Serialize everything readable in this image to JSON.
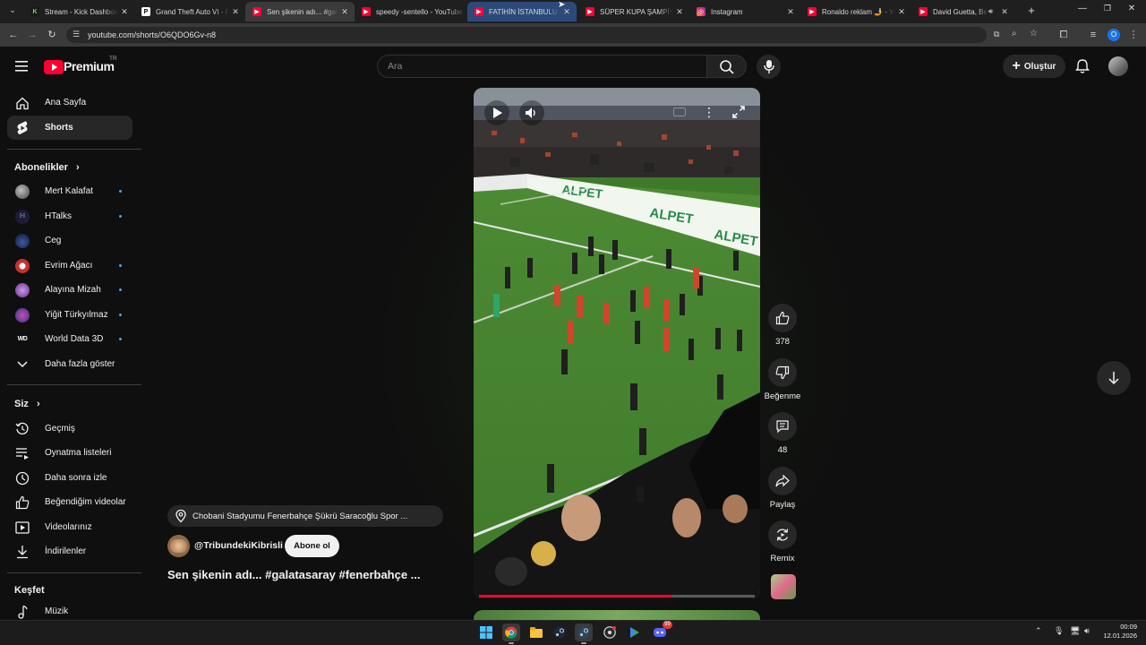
{
  "browser": {
    "tabs": [
      {
        "title": "Stream - Kick Dashboard",
        "icon": "kick-icon",
        "color": "#53fc18"
      },
      {
        "title": "Grand Theft Auto VI - PlayStation",
        "icon": "playstation-icon",
        "color": "#ffffff"
      },
      {
        "title": "Sen şikenin adı... #galatasaray",
        "icon": "youtube-icon",
        "color": "#ff0033"
      },
      {
        "title": "speedy -sentello - YouTube",
        "icon": "youtube-icon",
        "color": "#ff0033"
      },
      {
        "title": "FATİHİN İSTANBULU FENER",
        "icon": "youtube-icon",
        "color": "#ff0033"
      },
      {
        "title": "SÜPER KUPA ŞAMPİYONU",
        "icon": "youtube-icon",
        "color": "#ff0033"
      },
      {
        "title": "Instagram",
        "icon": "instagram-icon",
        "color": "#e1306c"
      },
      {
        "title": "Ronaldo reklam 🤳 - YouTube",
        "icon": "youtube-icon",
        "color": "#ff0033"
      },
      {
        "title": "David Guetta, Bebe Rexha",
        "icon": "youtube-icon",
        "color": "#ff0033"
      }
    ],
    "url": "youtube.com/shorts/O6QDO6Gv-n8",
    "profile_initial": "O"
  },
  "header": {
    "logo_text": "Premium",
    "region": "TR",
    "search_placeholder": "Ara",
    "create_label": "Oluştur"
  },
  "sidebar": {
    "main": [
      {
        "label": "Ana Sayfa",
        "icon": "home-icon"
      },
      {
        "label": "Shorts",
        "icon": "shorts-icon"
      }
    ],
    "subscriptions_title": "Abonelikler",
    "subscriptions": [
      {
        "label": "Mert Kalafat",
        "color": "#7a7a7a",
        "new": true
      },
      {
        "label": "HTalks",
        "color": "#1c1c3a",
        "new": true
      },
      {
        "label": "Ceg",
        "color": "#1a2a5a",
        "new": false
      },
      {
        "label": "Evrim Ağacı",
        "color": "#c8302c",
        "new": true
      },
      {
        "label": "Alayına Mizah",
        "color": "#8a4ab0",
        "new": true
      },
      {
        "label": "Yiğit Türkyılmaz",
        "color": "#2a3a8a",
        "new": true
      },
      {
        "label": "World Data 3D",
        "color": "#202020",
        "new": true
      }
    ],
    "show_more_label": "Daha fazla göster",
    "you_title": "Siz",
    "you_items": [
      {
        "label": "Geçmiş",
        "icon": "history-icon"
      },
      {
        "label": "Oynatma listeleri",
        "icon": "playlist-icon"
      },
      {
        "label": "Daha sonra izle",
        "icon": "clock-icon"
      },
      {
        "label": "Beğendiğim videolar",
        "icon": "thumbs-up-icon"
      },
      {
        "label": "Videolarınız",
        "icon": "video-icon"
      },
      {
        "label": "İndirilenler",
        "icon": "download-icon"
      }
    ],
    "explore_title": "Keşfet",
    "explore_items": [
      {
        "label": "Müzik",
        "icon": "music-icon"
      }
    ]
  },
  "short": {
    "location": "Chobani Stadyumu Fenerbahçe Şükrü Saracoğlu Spor ...",
    "channel": "@TribundekiKibrisli",
    "subscribe_label": "Abone ol",
    "title": "Sen şikenin adı... #galatasaray #fenerbahçe ...",
    "board_text": "ALPET",
    "progress": 0.7,
    "actions": {
      "like_count": "378",
      "dislike_label": "Beğenme",
      "comment_count": "48",
      "share_label": "Paylaş",
      "remix_label": "Remix"
    }
  },
  "taskbar": {
    "time": "00:09",
    "date": "12.01.2026",
    "discord_badge": "99"
  },
  "colors": {
    "youtube_red": "#ff0033",
    "accent_blue": "#3ea6ff",
    "progress_red": "#ff0033"
  }
}
